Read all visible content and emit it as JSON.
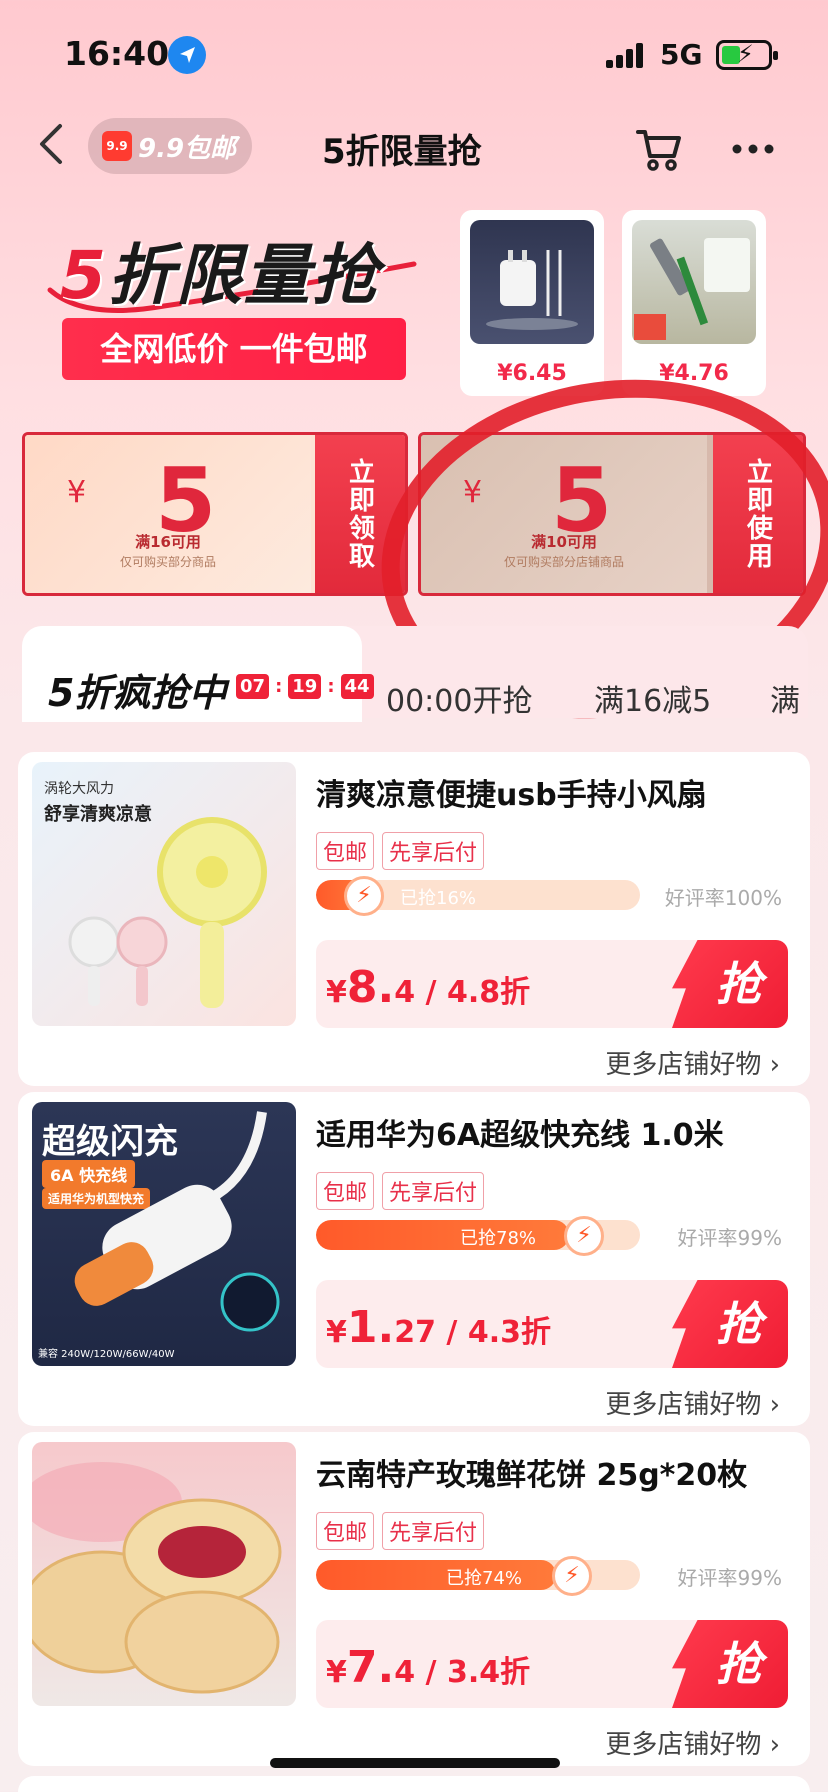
{
  "status_bar": {
    "time": "16:40",
    "network": "5G"
  },
  "nav": {
    "back_icon": "chevron-left-icon",
    "pill_badge": "9.9",
    "pill_label": "9.9包邮",
    "title": "5折限量抢",
    "cart_icon": "cart-icon",
    "more_icon": "more-icon"
  },
  "banner": {
    "title_five": "5",
    "title_rest": "折限量抢",
    "subtitle": "全网低价 一件包邮",
    "mini_products": [
      {
        "price": "¥6.45",
        "image": "charger-image"
      },
      {
        "price": "¥4.76",
        "image": "squeegee-image"
      }
    ]
  },
  "coupons": [
    {
      "currency": "¥",
      "amount": "5",
      "condition": "满16可用",
      "scope": "仅可购买部分商品",
      "action": "立即领取"
    },
    {
      "currency": "¥",
      "amount": "5",
      "condition": "满10可用",
      "scope": "仅可购买部分店铺商品",
      "action": "立即使用"
    }
  ],
  "tabs": {
    "active_label": "5折疯抢中",
    "countdown": [
      "07",
      "19",
      "44"
    ],
    "items": [
      "00:00开抢",
      "满16减5",
      "满"
    ]
  },
  "products": [
    {
      "title": "清爽凉意便捷usb手持小风扇",
      "tags": [
        "包邮",
        "先享后付"
      ],
      "sold_label": "已抢16%",
      "sold_fraction": 0.16,
      "rating": "好评率100%",
      "price_big": "8.",
      "price_small": "4",
      "discount": " / 4.8折",
      "currency": "¥",
      "grab": "抢",
      "more": "更多店铺好物",
      "image": "fan-image"
    },
    {
      "title": "适用华为6A超级快充线 1.0米",
      "tags": [
        "包邮",
        "先享后付"
      ],
      "sold_label": "已抢78%",
      "sold_fraction": 0.78,
      "rating": "好评率99%",
      "price_big": "1.",
      "price_small": "27",
      "discount": " / 4.3折",
      "currency": "¥",
      "grab": "抢",
      "more": "更多店铺好物",
      "image": "cable-image",
      "image_texts": {
        "headline": "超级闪充",
        "badge": "6A 快充线",
        "sub": "适用华为机型快充",
        "compat": "兼容 240W/120W/66W/40W"
      }
    },
    {
      "title": "云南特产玫瑰鲜花饼 25g*20枚",
      "tags": [
        "包邮",
        "先享后付"
      ],
      "sold_label": "已抢74%",
      "sold_fraction": 0.74,
      "rating": "好评率99%",
      "price_big": "7.",
      "price_small": "4",
      "discount": " / 3.4折",
      "currency": "¥",
      "grab": "抢",
      "more": "更多店铺好物",
      "image": "flower-cake-image"
    }
  ],
  "fan_image_texts": {
    "line1": "涡轮大风力",
    "line2": "舒享清爽凉意"
  },
  "colors": {
    "accent": "#ef2238",
    "coupon_border": "#d8293b",
    "background_top": "#ffc9cf"
  }
}
